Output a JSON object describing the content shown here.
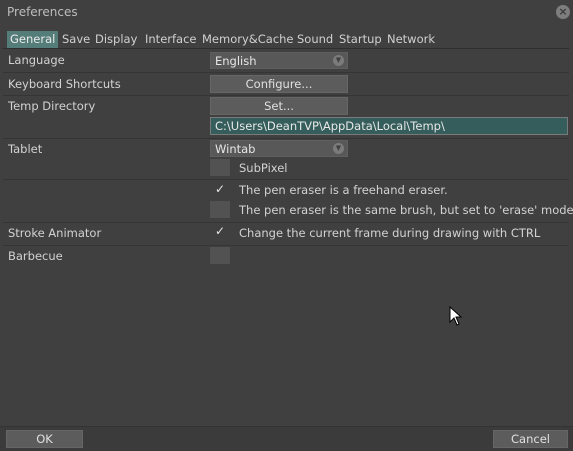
{
  "window": {
    "title": "Preferences"
  },
  "tabs": [
    "General",
    "Save",
    "Display",
    "Interface",
    "Memory&Cache",
    "Sound",
    "Startup",
    "Network"
  ],
  "general": {
    "language": {
      "label": "Language",
      "value": "English"
    },
    "shortcuts": {
      "label": "Keyboard Shortcuts",
      "button": "Configure..."
    },
    "temp": {
      "label": "Temp Directory",
      "button": "Set...",
      "path": "C:\\Users\\DeanTVP\\AppData\\Local\\Temp\\"
    },
    "tablet": {
      "label": "Tablet",
      "value": "Wintab",
      "subpixel": "SubPixel",
      "subpixel_checked": false
    },
    "eraser": {
      "freehand": "The pen eraser is a freehand eraser.",
      "freehand_checked": true,
      "same_brush": "The pen eraser is the same brush, but set to 'erase' mode.",
      "same_brush_checked": false
    },
    "stroke": {
      "label": "Stroke Animator",
      "option": "Change the current frame during drawing with CTRL",
      "checked": true
    },
    "barbecue": {
      "label": "Barbecue",
      "checked": false
    }
  },
  "footer": {
    "ok": "OK",
    "cancel": "Cancel"
  },
  "colors": {
    "background": "#404040",
    "accent": "#547d7a",
    "path_field": "#355d5b"
  }
}
